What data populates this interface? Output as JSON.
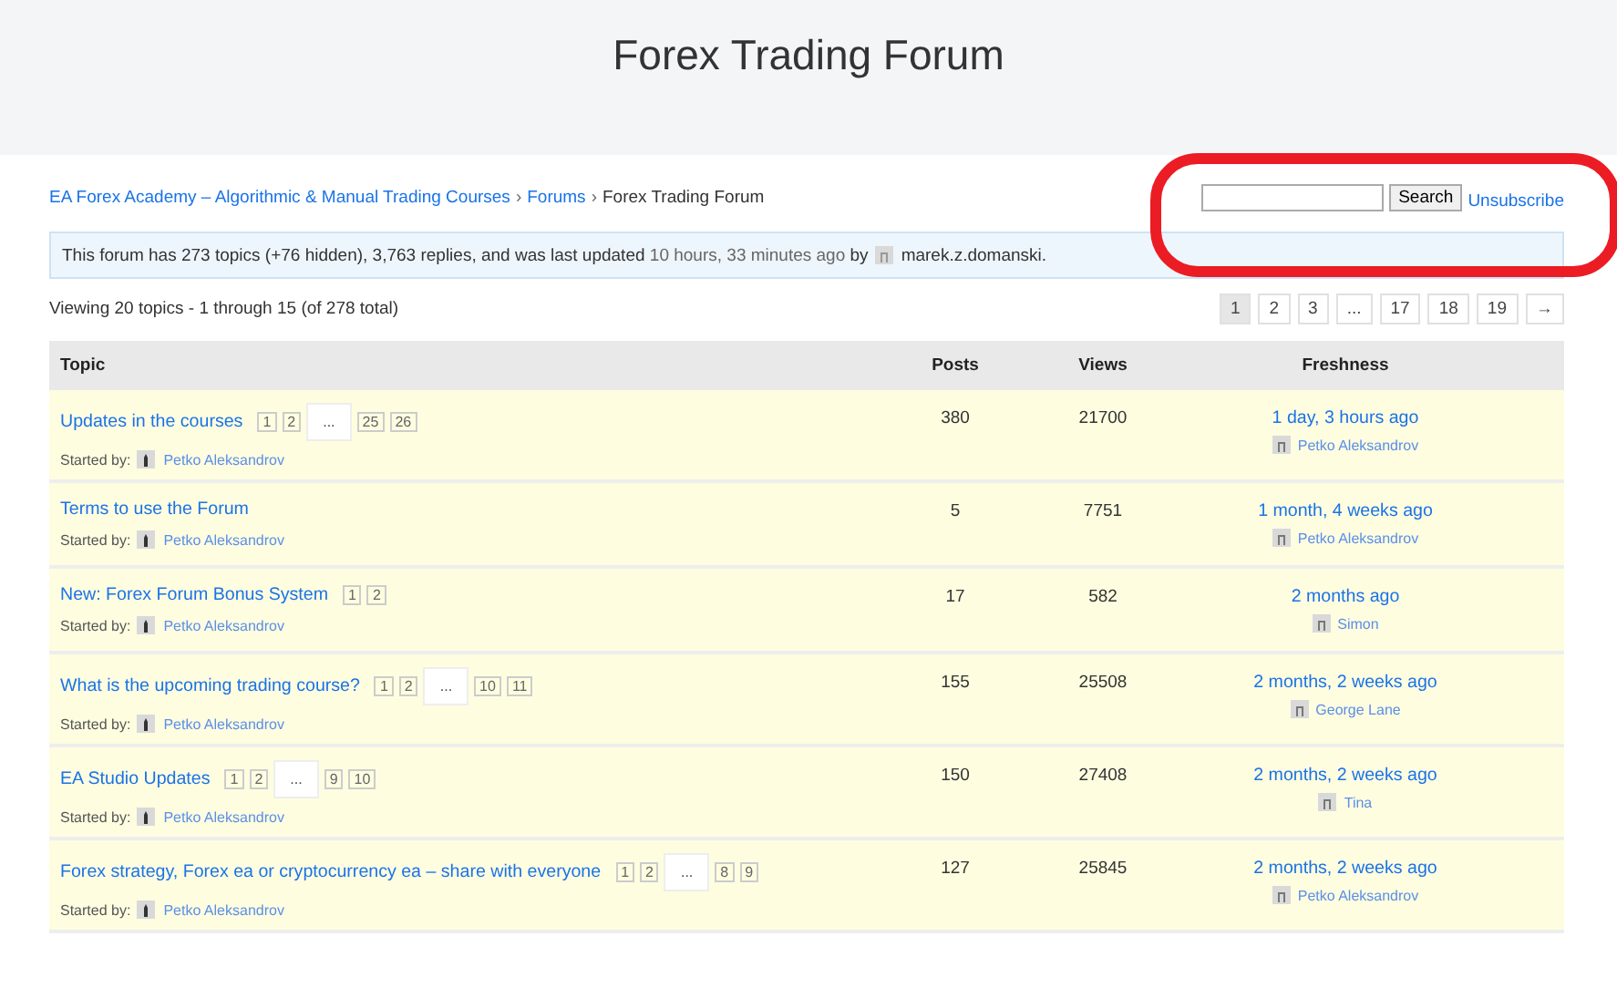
{
  "page_title": "Forex Trading Forum",
  "breadcrumb": [
    "EA Forex Academy – Algorithmic & Manual Trading Courses",
    "Forums",
    "Forex Trading Forum"
  ],
  "breadcrumb_separator": "›",
  "search": {
    "button": "Search"
  },
  "unsubscribe": "Unsubscribe",
  "info": {
    "text": "This forum has 273 topics (+76 hidden), 3,763 replies, and was last updated",
    "updated": "10 hours, 33 minutes ago",
    "by": "by",
    "author": "marek.z.domanski."
  },
  "viewing": "Viewing 20 topics - 1 through 15 (of 278 total)",
  "pagination": [
    {
      "label": "1",
      "selected": true
    },
    {
      "label": "2",
      "selected": false
    },
    {
      "label": "3",
      "selected": false
    },
    {
      "label": "...",
      "selected": false
    },
    {
      "label": "17",
      "selected": false
    },
    {
      "label": "18",
      "selected": false
    },
    {
      "label": "19",
      "selected": false
    },
    {
      "label": "→",
      "selected": false
    }
  ],
  "table": {
    "columns": [
      "Topic",
      "Posts",
      "Views",
      "Freshness"
    ],
    "rows": [
      {
        "title": "Updates in the courses",
        "pages": [
          {
            "label": "1",
            "kind": "page"
          },
          {
            "label": "2",
            "kind": "page"
          },
          {
            "label": "...",
            "kind": "gap"
          },
          {
            "label": "25",
            "kind": "page"
          },
          {
            "label": "26",
            "kind": "page"
          }
        ],
        "started_by": "Started by:",
        "author": "Petko Aleksandrov",
        "posts": "380",
        "views": "21700",
        "freshness": "1 day, 3 hours ago",
        "last_poster": "Petko Aleksandrov"
      },
      {
        "title": "Terms to use the Forum",
        "started_by": "Started by:",
        "author": "Petko Aleksandrov",
        "posts": "5",
        "views": "7751",
        "freshness": "1 month, 4 weeks ago",
        "last_poster": "Petko Aleksandrov"
      },
      {
        "title": "New: Forex Forum Bonus System",
        "pages": [
          {
            "label": "1",
            "kind": "page"
          },
          {
            "label": "2",
            "kind": "page"
          }
        ],
        "started_by": "Started by:",
        "author": "Petko Aleksandrov",
        "posts": "17",
        "views": "582",
        "freshness": "2 months ago",
        "last_poster": "Simon"
      },
      {
        "title": "What is the upcoming trading course?",
        "pages": [
          {
            "label": "1",
            "kind": "page"
          },
          {
            "label": "2",
            "kind": "page"
          },
          {
            "label": "...",
            "kind": "gap"
          },
          {
            "label": "10",
            "kind": "page"
          },
          {
            "label": "11",
            "kind": "page"
          }
        ],
        "started_by": "Started by:",
        "author": "Petko Aleksandrov",
        "posts": "155",
        "views": "25508",
        "freshness": "2 months, 2 weeks ago",
        "last_poster": "George Lane"
      },
      {
        "title": "EA Studio Updates",
        "pages": [
          {
            "label": "1",
            "kind": "page"
          },
          {
            "label": "2",
            "kind": "page"
          },
          {
            "label": "...",
            "kind": "gap"
          },
          {
            "label": "9",
            "kind": "page"
          },
          {
            "label": "10",
            "kind": "page"
          }
        ],
        "started_by": "Started by:",
        "author": "Petko Aleksandrov",
        "posts": "150",
        "views": "27408",
        "freshness": "2 months, 2 weeks ago",
        "last_poster": "Tina"
      },
      {
        "title": "Forex strategy, Forex ea or cryptocurrency ea – share with everyone",
        "pages": [
          {
            "label": "1",
            "kind": "page"
          },
          {
            "label": "2",
            "kind": "page"
          },
          {
            "label": "...",
            "kind": "gap"
          },
          {
            "label": "8",
            "kind": "page"
          },
          {
            "label": "9",
            "kind": "page"
          }
        ],
        "started_by": "Started by:",
        "author": "Petko Aleksandrov",
        "posts": "127",
        "views": "25845",
        "freshness": "2 months, 2 weeks ago",
        "last_poster": "Petko Aleksandrov"
      }
    ]
  }
}
